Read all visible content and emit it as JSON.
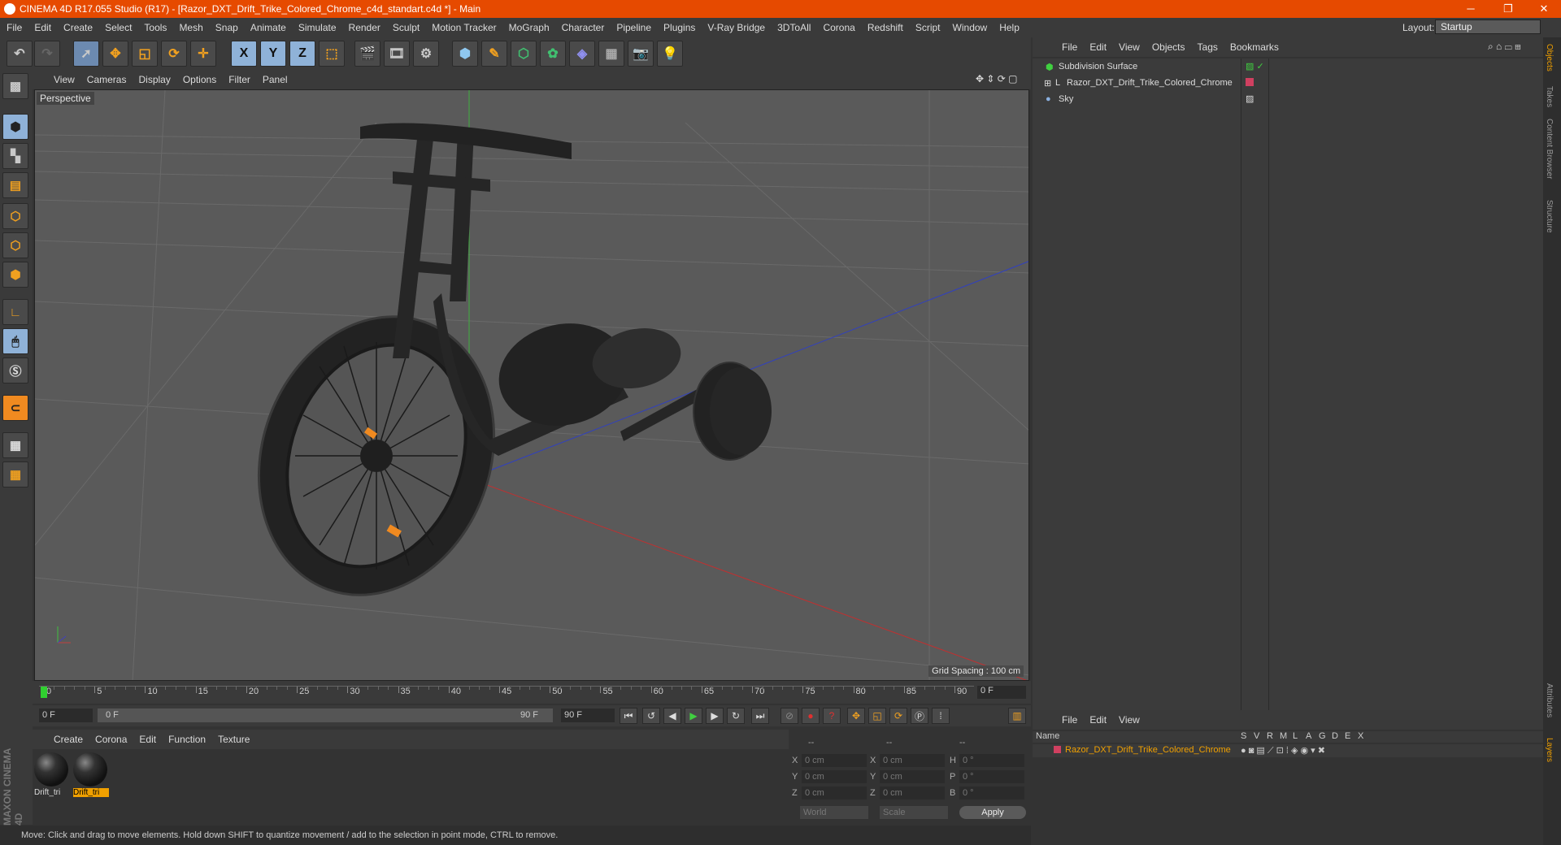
{
  "window": {
    "title": "CINEMA 4D R17.055 Studio (R17) - [Razor_DXT_Drift_Trike_Colored_Chrome_c4d_standart.c4d *] - Main",
    "minimize": "─",
    "maximize": "❐",
    "close": "✕"
  },
  "menu": [
    "File",
    "Edit",
    "Create",
    "Select",
    "Tools",
    "Mesh",
    "Snap",
    "Animate",
    "Simulate",
    "Render",
    "Sculpt",
    "Motion Tracker",
    "MoGraph",
    "Character",
    "Pipeline",
    "Plugins",
    "V-Ray Bridge",
    "3DToAll",
    "Corona",
    "Redshift",
    "Script",
    "Window",
    "Help"
  ],
  "layout": {
    "label": "Layout:",
    "value": "Startup"
  },
  "toolbar": {
    "x": "X",
    "y": "Y",
    "z": "Z"
  },
  "viewport": {
    "menu": [
      "View",
      "Cameras",
      "Display",
      "Options",
      "Filter",
      "Panel"
    ],
    "label": "Perspective",
    "grid_spacing": "Grid Spacing : 100 cm"
  },
  "timeline": {
    "ticks": [
      "0",
      "5",
      "10",
      "15",
      "20",
      "25",
      "30",
      "35",
      "40",
      "45",
      "50",
      "55",
      "60",
      "65",
      "70",
      "75",
      "80",
      "85",
      "90"
    ],
    "current_frame": "0 F",
    "start": "0 F",
    "range_start": "0 F",
    "range_end": "90 F",
    "end": "90 F"
  },
  "materials": {
    "menu": [
      "Create",
      "Corona",
      "Edit",
      "Function",
      "Texture"
    ],
    "items": [
      {
        "name": "Drift_tri"
      },
      {
        "name": "Drift_tri"
      }
    ]
  },
  "coords": {
    "header": [
      "--",
      "--",
      "--"
    ],
    "pos": [
      {
        "axis": "X",
        "value": "0 cm"
      },
      {
        "axis": "Y",
        "value": "0 cm"
      },
      {
        "axis": "Z",
        "value": "0 cm"
      }
    ],
    "size": [
      {
        "axis": "X",
        "value": "0 cm"
      },
      {
        "axis": "Y",
        "value": "0 cm"
      },
      {
        "axis": "Z",
        "value": "0 cm"
      }
    ],
    "rot": [
      {
        "axis": "H",
        "value": "0 °"
      },
      {
        "axis": "P",
        "value": "0 °"
      },
      {
        "axis": "B",
        "value": "0 °"
      }
    ],
    "world": "World",
    "scale": "Scale",
    "apply": "Apply"
  },
  "objects": {
    "menu": [
      "File",
      "Edit",
      "View",
      "Objects",
      "Tags",
      "Bookmarks"
    ],
    "items": [
      {
        "name": "Subdivision Surface"
      },
      {
        "name": "Razor_DXT_Drift_Trike_Colored_Chrome"
      },
      {
        "name": "Sky"
      }
    ]
  },
  "layers": {
    "menu": [
      "File",
      "Edit",
      "View"
    ],
    "header_name": "Name",
    "columns": [
      "S",
      "V",
      "R",
      "M",
      "L",
      "A",
      "G",
      "D",
      "E",
      "X"
    ],
    "row_name": "Razor_DXT_Drift_Trike_Colored_Chrome"
  },
  "sidetabs": [
    "Objects",
    "Takes",
    "Content Browser",
    "Structure",
    "Attributes",
    "Layers"
  ],
  "status": "Move: Click and drag to move elements. Hold down SHIFT to quantize movement / add to the selection in point mode, CTRL to remove.",
  "brand": "MAXON CINEMA 4D",
  "colors": {
    "title_bar": "#e64a00",
    "accent": "#f0a000"
  }
}
